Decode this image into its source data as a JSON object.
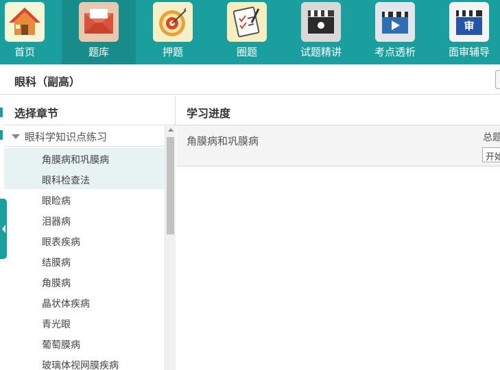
{
  "nav": {
    "items": [
      {
        "label": "首页",
        "icon": "house-icon",
        "tile_color": "#f3f7d6",
        "active": false
      },
      {
        "label": "题库",
        "icon": "mail-icon",
        "tile_color": "#e8c9b0",
        "active": true
      },
      {
        "label": "押题",
        "icon": "target-icon",
        "tile_color": "#f6f0c8",
        "active": false
      },
      {
        "label": "圈题",
        "icon": "clipboard-icon",
        "tile_color": "#f7eec0",
        "active": false
      },
      {
        "label": "试题精讲",
        "icon": "clapperboard-icon",
        "tile_color": "#d8d8d8",
        "active": false
      },
      {
        "label": "考点透析",
        "icon": "video-icon",
        "tile_color": "#e2e6ea",
        "active": false
      },
      {
        "label": "面审辅导",
        "icon": "clapperboard-shen-icon",
        "tile_color": "#f4f4f4",
        "active": false
      }
    ],
    "shen_glyph": "审"
  },
  "subject": {
    "title": "眼科（副高）"
  },
  "chapters": {
    "heading": "选择章节",
    "root": "眼科学知识点练习",
    "items": [
      "角膜病和巩膜病",
      "眼科检查法",
      "眼睑病",
      "泪器病",
      "眼表疾病",
      "结膜病",
      "角膜病",
      "晶状体疾病",
      "青光眼",
      "葡萄膜病",
      "玻璃体视网膜疾病"
    ]
  },
  "progress": {
    "heading": "学习进度",
    "chapter": "角膜病和巩膜病",
    "total_label": "总题",
    "start_label": "开始"
  },
  "colors": {
    "accent": "#1a9f9e",
    "highlight": "#e7f2f2"
  }
}
